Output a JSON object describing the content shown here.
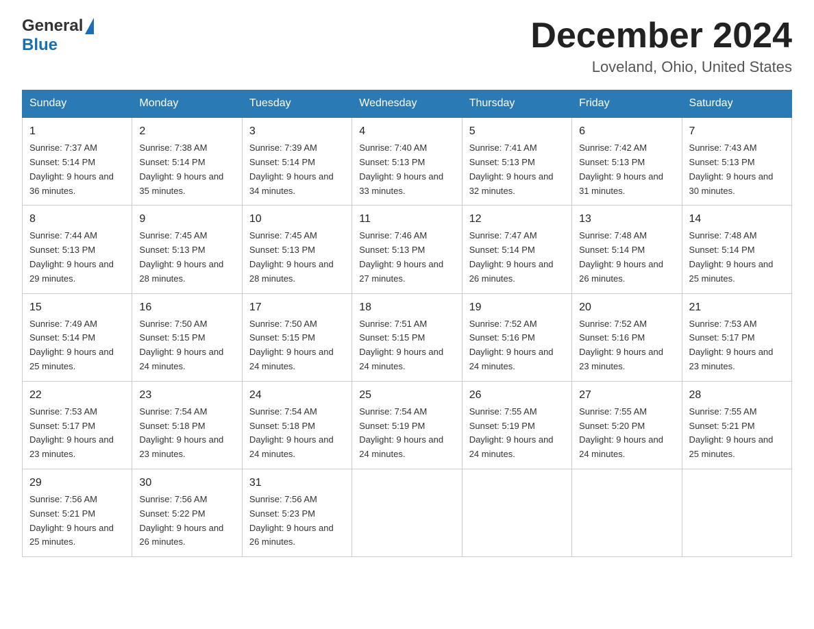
{
  "header": {
    "logo_general": "General",
    "logo_blue": "Blue",
    "month_title": "December 2024",
    "location": "Loveland, Ohio, United States"
  },
  "weekdays": [
    "Sunday",
    "Monday",
    "Tuesday",
    "Wednesday",
    "Thursday",
    "Friday",
    "Saturday"
  ],
  "weeks": [
    [
      {
        "day": "1",
        "sunrise": "7:37 AM",
        "sunset": "5:14 PM",
        "daylight": "9 hours and 36 minutes."
      },
      {
        "day": "2",
        "sunrise": "7:38 AM",
        "sunset": "5:14 PM",
        "daylight": "9 hours and 35 minutes."
      },
      {
        "day": "3",
        "sunrise": "7:39 AM",
        "sunset": "5:14 PM",
        "daylight": "9 hours and 34 minutes."
      },
      {
        "day": "4",
        "sunrise": "7:40 AM",
        "sunset": "5:13 PM",
        "daylight": "9 hours and 33 minutes."
      },
      {
        "day": "5",
        "sunrise": "7:41 AM",
        "sunset": "5:13 PM",
        "daylight": "9 hours and 32 minutes."
      },
      {
        "day": "6",
        "sunrise": "7:42 AM",
        "sunset": "5:13 PM",
        "daylight": "9 hours and 31 minutes."
      },
      {
        "day": "7",
        "sunrise": "7:43 AM",
        "sunset": "5:13 PM",
        "daylight": "9 hours and 30 minutes."
      }
    ],
    [
      {
        "day": "8",
        "sunrise": "7:44 AM",
        "sunset": "5:13 PM",
        "daylight": "9 hours and 29 minutes."
      },
      {
        "day": "9",
        "sunrise": "7:45 AM",
        "sunset": "5:13 PM",
        "daylight": "9 hours and 28 minutes."
      },
      {
        "day": "10",
        "sunrise": "7:45 AM",
        "sunset": "5:13 PM",
        "daylight": "9 hours and 28 minutes."
      },
      {
        "day": "11",
        "sunrise": "7:46 AM",
        "sunset": "5:13 PM",
        "daylight": "9 hours and 27 minutes."
      },
      {
        "day": "12",
        "sunrise": "7:47 AM",
        "sunset": "5:14 PM",
        "daylight": "9 hours and 26 minutes."
      },
      {
        "day": "13",
        "sunrise": "7:48 AM",
        "sunset": "5:14 PM",
        "daylight": "9 hours and 26 minutes."
      },
      {
        "day": "14",
        "sunrise": "7:48 AM",
        "sunset": "5:14 PM",
        "daylight": "9 hours and 25 minutes."
      }
    ],
    [
      {
        "day": "15",
        "sunrise": "7:49 AM",
        "sunset": "5:14 PM",
        "daylight": "9 hours and 25 minutes."
      },
      {
        "day": "16",
        "sunrise": "7:50 AM",
        "sunset": "5:15 PM",
        "daylight": "9 hours and 24 minutes."
      },
      {
        "day": "17",
        "sunrise": "7:50 AM",
        "sunset": "5:15 PM",
        "daylight": "9 hours and 24 minutes."
      },
      {
        "day": "18",
        "sunrise": "7:51 AM",
        "sunset": "5:15 PM",
        "daylight": "9 hours and 24 minutes."
      },
      {
        "day": "19",
        "sunrise": "7:52 AM",
        "sunset": "5:16 PM",
        "daylight": "9 hours and 24 minutes."
      },
      {
        "day": "20",
        "sunrise": "7:52 AM",
        "sunset": "5:16 PM",
        "daylight": "9 hours and 23 minutes."
      },
      {
        "day": "21",
        "sunrise": "7:53 AM",
        "sunset": "5:17 PM",
        "daylight": "9 hours and 23 minutes."
      }
    ],
    [
      {
        "day": "22",
        "sunrise": "7:53 AM",
        "sunset": "5:17 PM",
        "daylight": "9 hours and 23 minutes."
      },
      {
        "day": "23",
        "sunrise": "7:54 AM",
        "sunset": "5:18 PM",
        "daylight": "9 hours and 23 minutes."
      },
      {
        "day": "24",
        "sunrise": "7:54 AM",
        "sunset": "5:18 PM",
        "daylight": "9 hours and 24 minutes."
      },
      {
        "day": "25",
        "sunrise": "7:54 AM",
        "sunset": "5:19 PM",
        "daylight": "9 hours and 24 minutes."
      },
      {
        "day": "26",
        "sunrise": "7:55 AM",
        "sunset": "5:19 PM",
        "daylight": "9 hours and 24 minutes."
      },
      {
        "day": "27",
        "sunrise": "7:55 AM",
        "sunset": "5:20 PM",
        "daylight": "9 hours and 24 minutes."
      },
      {
        "day": "28",
        "sunrise": "7:55 AM",
        "sunset": "5:21 PM",
        "daylight": "9 hours and 25 minutes."
      }
    ],
    [
      {
        "day": "29",
        "sunrise": "7:56 AM",
        "sunset": "5:21 PM",
        "daylight": "9 hours and 25 minutes."
      },
      {
        "day": "30",
        "sunrise": "7:56 AM",
        "sunset": "5:22 PM",
        "daylight": "9 hours and 26 minutes."
      },
      {
        "day": "31",
        "sunrise": "7:56 AM",
        "sunset": "5:23 PM",
        "daylight": "9 hours and 26 minutes."
      },
      null,
      null,
      null,
      null
    ]
  ]
}
